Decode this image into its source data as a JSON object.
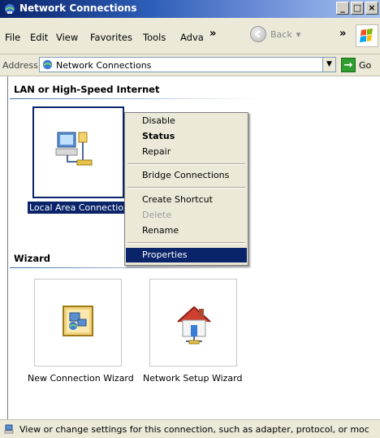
{
  "window": {
    "title": "Network Connections",
    "minimize": "_",
    "maximize": "□",
    "close": "×"
  },
  "menu": {
    "items": [
      "File",
      "Edit",
      "View",
      "Favorites",
      "Tools",
      "Adva"
    ],
    "chevron": "»",
    "back_label": "Back",
    "back_arrow": "▾"
  },
  "address": {
    "label": "Address",
    "value": "Network Connections",
    "go_label": "Go",
    "dropdown": "▼",
    "go_arrow": "→"
  },
  "groups": {
    "lan": "LAN or High-Speed Internet",
    "wizard": "Wizard"
  },
  "items": {
    "local_area": "Local Area Connection",
    "new_connection_wizard": "New Connection Wizard",
    "network_setup_wizard": "Network Setup Wizard"
  },
  "context_menu": {
    "disable": "Disable",
    "status": "Status",
    "repair": "Repair",
    "bridge": "Bridge Connections",
    "create_shortcut": "Create Shortcut",
    "delete": "Delete",
    "rename": "Rename",
    "properties": "Properties"
  },
  "status": {
    "text": "View or change settings for this connection, such as adapter, protocol, or moc"
  },
  "colors": {
    "selection": "#0a246a",
    "chrome": "#ece9d8",
    "title_start": "#0a246a",
    "title_end": "#a6c3ee"
  }
}
